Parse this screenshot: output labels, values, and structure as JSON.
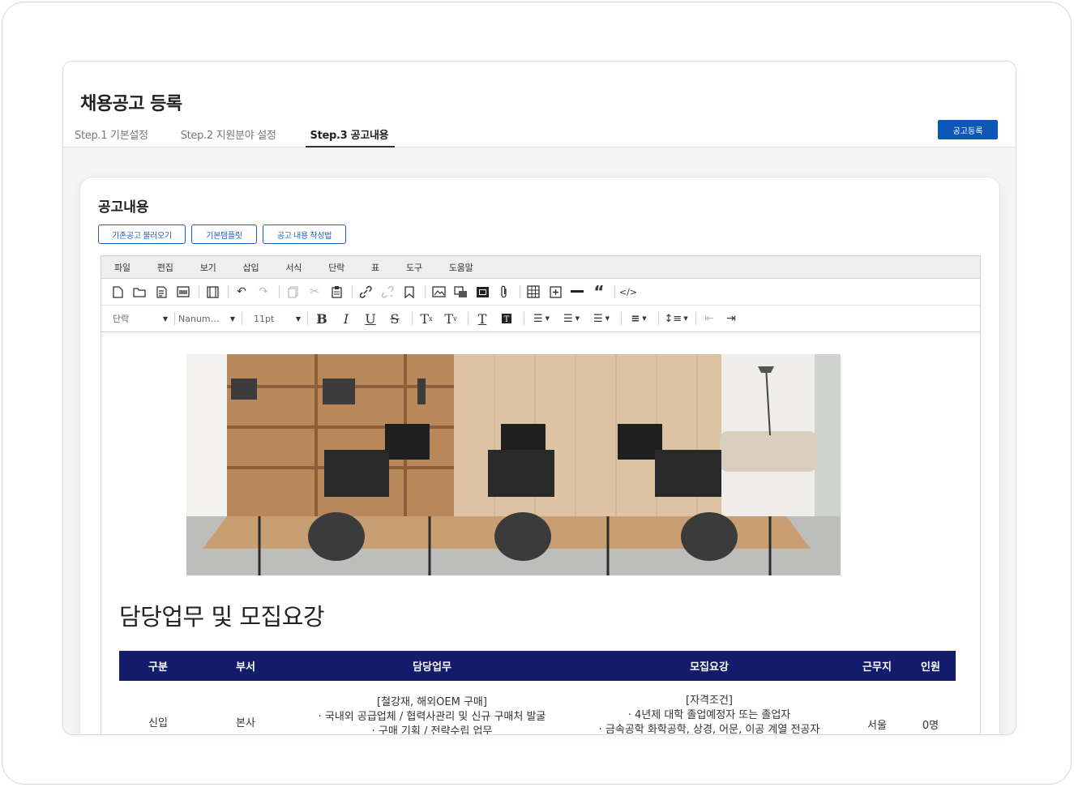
{
  "page": {
    "title": "채용공고 등록",
    "steps": [
      "Step.1 기본설정",
      "Step.2 지원분야 설정",
      "Step.3 공고내용"
    ],
    "active_step": 2,
    "register_button": "공고등록"
  },
  "card": {
    "title": "공고내용",
    "buttons": [
      "기존공고 불러오기",
      "기본템플릿",
      "공고 내용 작성법"
    ]
  },
  "editor": {
    "menu": [
      "파일",
      "편집",
      "보기",
      "삽입",
      "서식",
      "단락",
      "표",
      "도구",
      "도움말"
    ],
    "toolbar_icons": [
      "new-document-icon",
      "open-folder-icon",
      "template-icon",
      "preview-icon",
      "fullscreen-icon",
      "undo-icon",
      "redo-icon",
      "copy-icon",
      "cut-icon",
      "paste-icon",
      "link-icon",
      "unlink-icon",
      "bookmark-icon",
      "image-icon",
      "media-icon",
      "video-icon",
      "attachment-icon",
      "table-icon",
      "insert-icon",
      "horizontal-rule-icon",
      "blockquote-icon",
      "code-icon"
    ],
    "format": {
      "block": "단락",
      "font": "Nanum…",
      "size": "11pt"
    }
  },
  "content": {
    "heading": "담당업무 및 모집요강",
    "table": {
      "headers": [
        "구분",
        "부서",
        "담당업무",
        "모집요강",
        "근무지",
        "인원"
      ],
      "row": {
        "type": "신입",
        "dept": "본사",
        "duties": [
          "[철강재, 해외OEM 구매]",
          "· 국내외 공급업체 / 협력사관리 및 신규 구매처 발굴",
          "· 구매 기획 / 전략수립 업무"
        ],
        "requirements": [
          "[자격조건]",
          "· 4년제 대학 졸업예정자 또는 졸업자",
          "· 금속공학 화학공학, 상경, 어문, 이공 계열 전공자"
        ],
        "location": "서울",
        "count": "0명"
      }
    }
  }
}
